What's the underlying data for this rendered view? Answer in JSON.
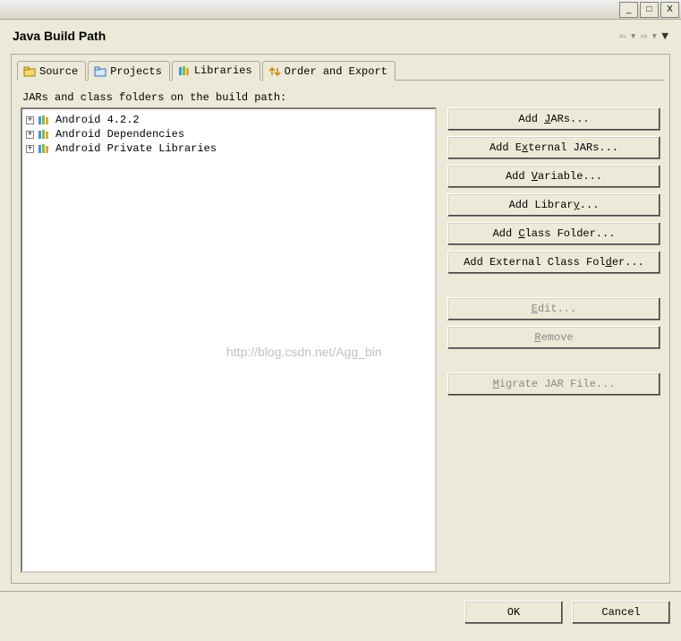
{
  "titlebar": {
    "min": "_",
    "max": "□",
    "close": "X"
  },
  "header": {
    "title": "Java Build Path"
  },
  "tabs": {
    "source": "Source",
    "projects": "Projects",
    "libraries": "Libraries",
    "order": "Order and Export"
  },
  "list_label": "JARs and class folders on the build path:",
  "tree": {
    "items": [
      {
        "label": "Android 4.2.2"
      },
      {
        "label": "Android Dependencies"
      },
      {
        "label": "Android Private Libraries"
      }
    ]
  },
  "buttons": {
    "add_jars": "Add JARs...",
    "add_external_jars": "Add External JARs...",
    "add_variable": "Add Variable...",
    "add_library": "Add Library...",
    "add_class_folder": "Add Class Folder...",
    "add_external_class_folder": "Add External Class Folder...",
    "edit": "Edit...",
    "remove": "Remove",
    "migrate": "Migrate JAR File..."
  },
  "footer": {
    "ok": "OK",
    "cancel": "Cancel"
  },
  "watermark": "http://blog.csdn.net/Agg_bin"
}
